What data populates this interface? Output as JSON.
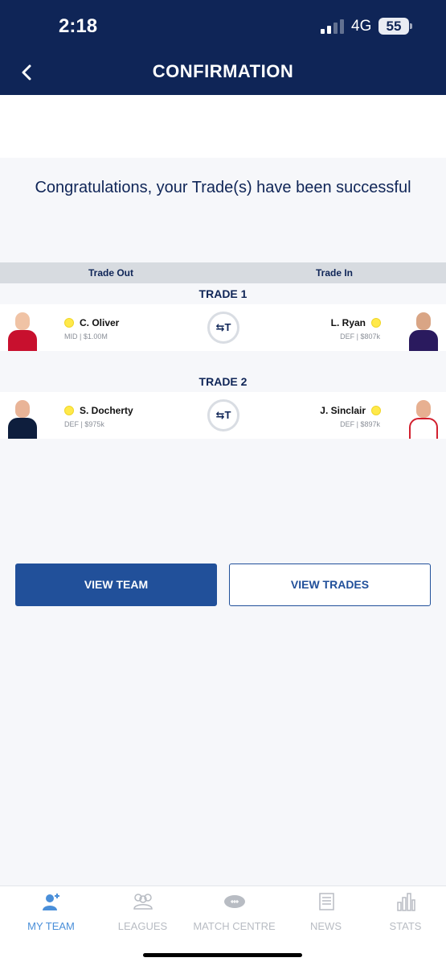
{
  "status_bar": {
    "time": "2:18",
    "network": "4G",
    "battery": "55"
  },
  "header": {
    "title": "CONFIRMATION"
  },
  "message": "Congratulations, your Trade(s) have been successful",
  "columns": {
    "out": "Trade Out",
    "in": "Trade In"
  },
  "trades": [
    {
      "label": "TRADE 1",
      "out": {
        "name": "C. Oliver",
        "meta": "MID | $1.00M",
        "guernsey": "#c8102e"
      },
      "in": {
        "name": "L. Ryan",
        "meta": "DEF | $807k",
        "guernsey": "#2a1a5e"
      }
    },
    {
      "label": "TRADE 2",
      "out": {
        "name": "S. Docherty",
        "meta": "DEF | $975k",
        "guernsey": "#0e1e3d"
      },
      "in": {
        "name": "J. Sinclair",
        "meta": "DEF | $897k",
        "guernsey": "#ffffff"
      }
    }
  ],
  "swap_icon_label": "T",
  "buttons": {
    "view_team": "VIEW TEAM",
    "view_trades": "VIEW TRADES"
  },
  "tabs": [
    {
      "label": "MY TEAM",
      "icon": "user-icon",
      "active": true
    },
    {
      "label": "LEAGUES",
      "icon": "group-icon",
      "active": false
    },
    {
      "label": "MATCH CENTRE",
      "icon": "football-icon",
      "active": false
    },
    {
      "label": "NEWS",
      "icon": "news-icon",
      "active": false
    },
    {
      "label": "STATS",
      "icon": "bar-chart-icon",
      "active": false
    }
  ],
  "colors": {
    "primary": "#0f2557",
    "button": "#21509a",
    "active_tab": "#4a8fd9"
  }
}
